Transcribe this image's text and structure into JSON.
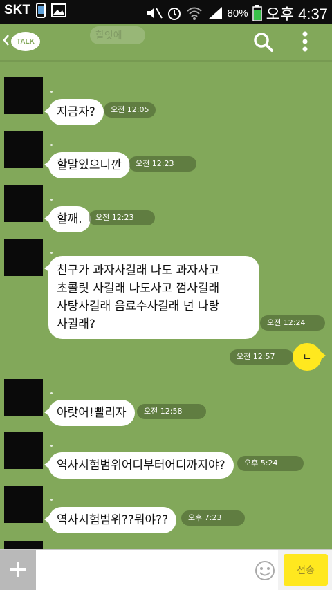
{
  "status_bar": {
    "carrier": "SKT",
    "battery_percent": "80%",
    "time": "오후 4:37"
  },
  "header": {
    "talk_logo": "TALK",
    "ghost_text": "할잇에"
  },
  "messages": [
    {
      "text": "지금자?",
      "time": "오전 12:05"
    },
    {
      "text": "할말있으니깐",
      "time": "오전 12:23"
    },
    {
      "text": "할깨.",
      "time": "오전 12:23"
    },
    {
      "text": "친구가 과자사길래 나도 과자사고\n초콜릿 사길래 나도사고 껌사길래\n사탕사길래 음료수사길래 넌 나랑\n사귈래?",
      "time": "오전 12:24"
    },
    {
      "text": "아랏어!빨리자",
      "time": "오전 12:58"
    },
    {
      "text": "역사시험범위어디부터어디까지야?",
      "time": "오후 5:24"
    },
    {
      "text": "역사시험범위??뭐야??",
      "time": "오후 7:23"
    }
  ],
  "my_message": {
    "text": "ㄴ",
    "time": "오전 12:57"
  },
  "input_bar": {
    "placeholder": "",
    "send_label": "전송"
  },
  "colors": {
    "chat_background": "#82a85a",
    "my_bubble": "#ffe81f",
    "send_button": "#ffe81f"
  },
  "icons": [
    "back-chevron-icon",
    "search-icon",
    "more-vert-icon",
    "plus-icon",
    "emoji-icon",
    "gallery-icon",
    "phone-icon",
    "mute-icon",
    "alarm-icon",
    "wifi-icon",
    "signal-icon",
    "battery-icon"
  ]
}
